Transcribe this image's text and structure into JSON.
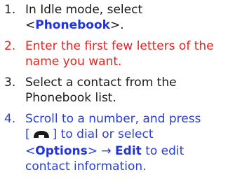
{
  "colors": {
    "text": "#1a1a1a",
    "highlight_red": "#e8231f",
    "highlight_blue": "#2a3fd4",
    "keyword_blue": "#2233dd"
  },
  "steps": [
    {
      "number": "1.",
      "color": "#1a1a1a",
      "before": "In Idle mode, select <",
      "keyword": "Phonebook",
      "after": ">."
    },
    {
      "number": "2.",
      "color": "#e8231f",
      "text": "Enter the first few letters of the name you want."
    },
    {
      "number": "3.",
      "color": "#1a1a1a",
      "text": "Select a contact from the Phonebook list."
    },
    {
      "number": "4.",
      "color": "#2a3fd4",
      "part1": "Scroll to a number, and press",
      "bracket_open": "[",
      "key_icon": "call-key-icon",
      "bracket_close": "] to dial or select",
      "lt": "<",
      "keyword1": "Options",
      "arrow": "> →",
      "keyword2": "Edit",
      "part2": "to edit contact information."
    }
  ]
}
